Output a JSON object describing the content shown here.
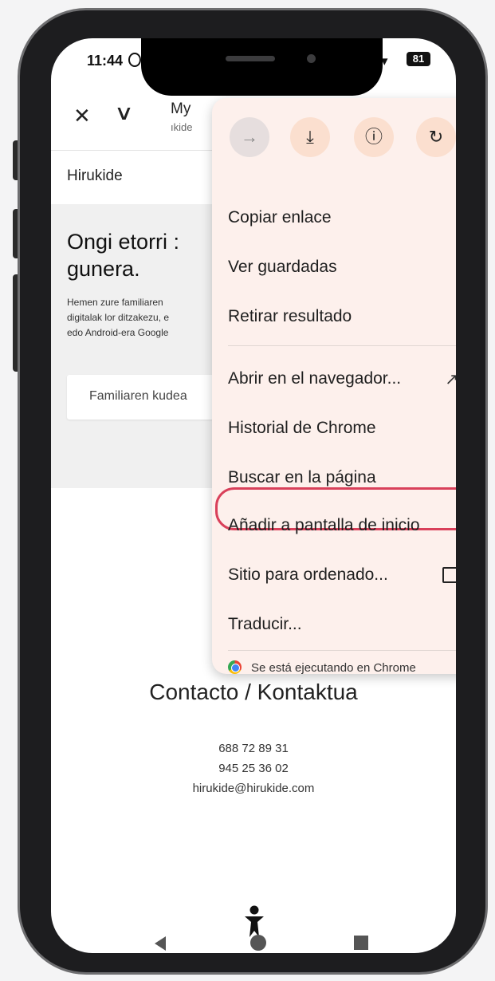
{
  "status_bar": {
    "time": "11:44",
    "battery": "81"
  },
  "toolbar": {
    "title": "My",
    "url": "ıkide"
  },
  "page": {
    "brand": "Hirukide",
    "hero_title": "Ongi etorri :\ngunera.",
    "hero_text": "Hemen zure familiaren\ndigitalak lor ditzakezu, e\nedo Android-era Google",
    "hero_button": "Familiaren kudea",
    "contact_title": "Contacto / Kontaktua",
    "phone1": "688 72 89 31",
    "phone2": "945 25 36 02",
    "email": "hirukide@hirukide.com"
  },
  "menu": {
    "icons": [
      "forward-icon",
      "download-icon",
      "info-icon",
      "refresh-icon"
    ],
    "items": [
      "Copiar enlace",
      "Ver guardadas",
      "Retirar resultado",
      "Abrir en el navegador...",
      "Historial de Chrome",
      "Buscar en la página",
      "Añadir a pantalla de inicio",
      "Sitio para ordenado...",
      "Traducir..."
    ],
    "footer": "Se está ejecutando en Chrome",
    "highlight_color": "#d9405a",
    "background_color": "#fdf0ec"
  }
}
